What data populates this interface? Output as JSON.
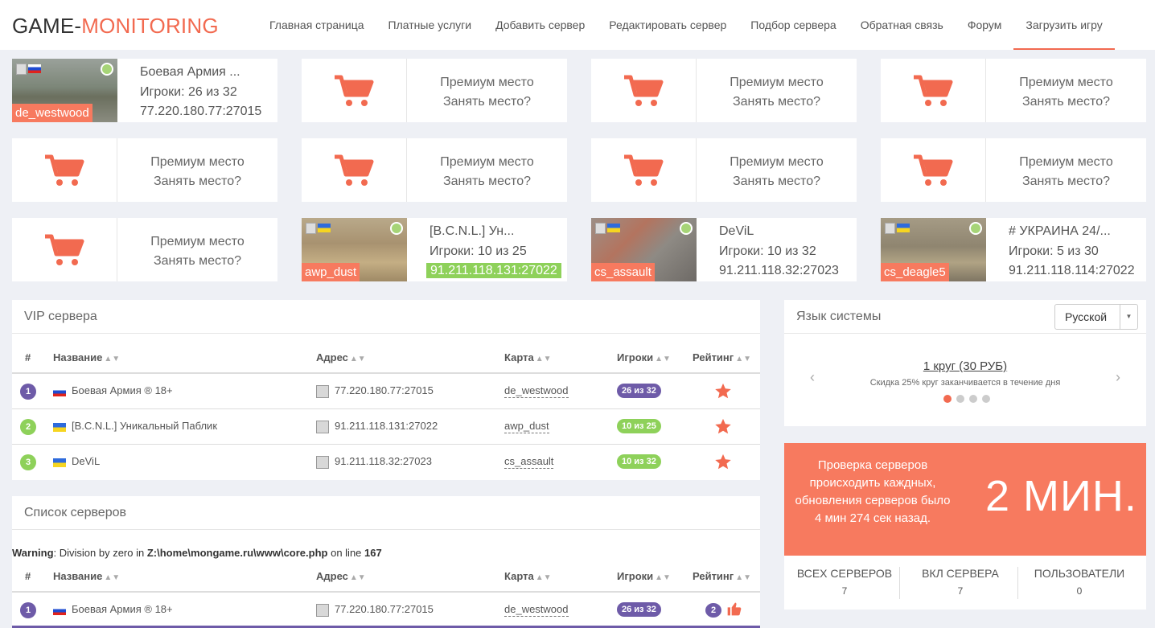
{
  "logo": {
    "part1": "GAME-",
    "part2": "MONITORING"
  },
  "nav": [
    {
      "label": "Главная страница"
    },
    {
      "label": "Платные услуги"
    },
    {
      "label": "Добавить сервер"
    },
    {
      "label": "Редактировать сервер"
    },
    {
      "label": "Подбор сервера"
    },
    {
      "label": "Обратная связь"
    },
    {
      "label": "Форум"
    },
    {
      "label": "Загрузить игру"
    }
  ],
  "premium": {
    "line1": "Премиум место",
    "line2": "Занять место?"
  },
  "server_tiles": [
    {
      "map": "de_westwood",
      "name": "Боевая Армия ...",
      "players": "Игроки: 26 из 32",
      "ip": "77.220.180.77:27015",
      "flag": "ru"
    },
    {
      "map": "awp_dust",
      "name": "[B.C.N.L.] Ун...",
      "players": "Игроки: 10 из 25",
      "ip": "91.211.118.131:27022",
      "flag": "ua"
    },
    {
      "map": "cs_assault",
      "name": "DeViL",
      "players": "Игроки: 10 из 32",
      "ip": "91.211.118.32:27023",
      "flag": "ua"
    },
    {
      "map": "cs_deagle5",
      "name": "# УКРАИНА 24/...",
      "players": "Игроки: 5 из 30",
      "ip": "91.211.118.114:27022",
      "flag": "ua"
    }
  ],
  "vip": {
    "title": "VIP сервера",
    "headers": {
      "num": "#",
      "name": "Название",
      "addr": "Адрес",
      "map": "Карта",
      "players": "Игроки",
      "rating": "Рейтинг"
    },
    "rows": [
      {
        "num": "1",
        "name": "Боевая Армия ® 18+",
        "addr": "77.220.180.77:27015",
        "map": "de_westwood",
        "players": "26 из 32"
      },
      {
        "num": "2",
        "name": "[B.C.N.L.] Уникальный Паблик",
        "addr": "91.211.118.131:27022",
        "map": "awp_dust",
        "players": "10 из 25"
      },
      {
        "num": "3",
        "name": "DeViL",
        "addr": "91.211.118.32:27023",
        "map": "cs_assault",
        "players": "10 из 32"
      }
    ]
  },
  "list": {
    "title": "Список серверов",
    "warning": {
      "label": "Warning",
      "text1": ": Division by zero in ",
      "path": "Z:\\home\\mongame.ru\\www\\core.php",
      "text2": " on line ",
      "line": "167"
    },
    "rows": [
      {
        "num": "1",
        "name": "Боевая Армия ® 18+",
        "addr": "77.220.180.77:27015",
        "map": "de_westwood",
        "players": "26 из 32",
        "likes": "2"
      }
    ]
  },
  "language": {
    "title": "Язык системы",
    "selected": "Русской"
  },
  "promo": {
    "link": "1 круг (30 РУБ)",
    "sub": "Скидка 25% круг заканчивается в течение дня"
  },
  "check": {
    "text": "Проверка серверов происходить каждных, обновления серверов было 4 мин 274 сек назад.",
    "big": "2 МИН."
  },
  "stats": [
    {
      "label": "ВСЕХ СЕРВЕРОВ",
      "value": "7"
    },
    {
      "label": "ВКЛ СЕРВЕРА",
      "value": "7"
    },
    {
      "label": "ПОЛЬЗОВАТЕЛИ",
      "value": "0"
    }
  ],
  "colors": {
    "accent": "#f26a50",
    "purple": "#6e5ba8",
    "green": "#8ed15a"
  }
}
